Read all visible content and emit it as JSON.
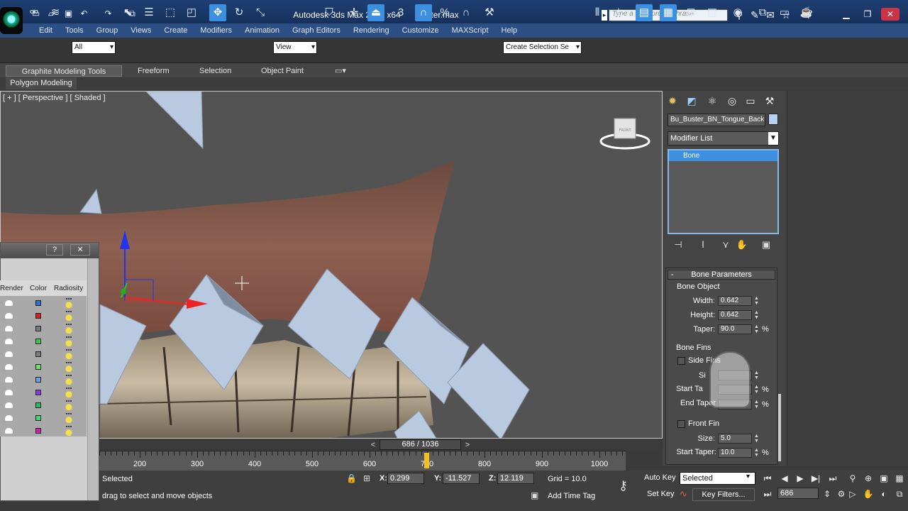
{
  "titlebar": {
    "app_title": "Autodesk 3ds Max  2012 x64",
    "file_name": "Buster.max",
    "search_placeholder": "Type a keyword or phrase",
    "quick_access": [
      "new-icon",
      "open-icon",
      "save-icon",
      "undo-icon",
      "redo-icon",
      "project-icon"
    ]
  },
  "menus": [
    "Edit",
    "Tools",
    "Group",
    "Views",
    "Create",
    "Modifiers",
    "Animation",
    "Graph Editors",
    "Rendering",
    "Customize",
    "MAXScript",
    "Help"
  ],
  "toolbar": {
    "filter_value": "All",
    "refcoord_value": "View",
    "snap_value": "3",
    "named_selection": "Create Selection Se"
  },
  "ribbon": {
    "tabs": [
      "Graphite Modeling Tools",
      "Freeform",
      "Selection",
      "Object Paint"
    ],
    "panel": "Polygon Modeling"
  },
  "viewport": {
    "label": "[ + ] [ Perspective ] [ Shaded ]",
    "viewcube_face": "FRONT"
  },
  "command_panel": {
    "object_name": "Bu_Buster_BN_Tongue_Back",
    "modifier_list": "Modifier List",
    "stack_item": "Bone",
    "bone_params_title": "Bone Parameters",
    "bone_object": {
      "title": "Bone Object",
      "width_label": "Width:",
      "width": "0.642",
      "height_label": "Height:",
      "height": "0.642",
      "taper_label": "Taper:",
      "taper": "90.0"
    },
    "bone_fins": {
      "title": "Bone Fins",
      "side_fins": "Side Fins",
      "size_label_partial": "Si",
      "start_taper_partial": "Start Ta",
      "end_taper_partial": "End Taper",
      "front_fin": "Front Fin",
      "size_label": "Size:",
      "size": "5.0",
      "start_taper_label": "Start Taper:",
      "start_taper": "10.0"
    },
    "percent": "%"
  },
  "floater": {
    "help": "?",
    "close": "✕",
    "columns": [
      "Render",
      "Color",
      "Radiosity"
    ],
    "row_colors": [
      "#2f6fd8",
      "#d82020",
      "#7a7a7a",
      "#3ec84a",
      "#7a7a7a",
      "#6ee070",
      "#6aa0e8",
      "#8a3ce0",
      "#24c060",
      "#3ed878",
      "#d020b0"
    ]
  },
  "timeline": {
    "frame_display": "686 / 1036",
    "prev": "<",
    "next": ">",
    "ticks": [
      "200",
      "300",
      "400",
      "500",
      "600",
      "700",
      "800",
      "900",
      "1000"
    ]
  },
  "status": {
    "selection": "Selected",
    "prompt": "drag to select and move objects",
    "x_label": "X:",
    "x": "0.299",
    "y_label": "Y:",
    "y": "-11.527",
    "z_label": "Z:",
    "z": "12.119",
    "grid": "Grid = 10.0",
    "add_time_tag": "Add Time Tag",
    "auto_key": "Auto Key",
    "set_key": "Set Key",
    "key_mode": "Selected",
    "key_filters": "Key Filters...",
    "current_frame": "686"
  }
}
